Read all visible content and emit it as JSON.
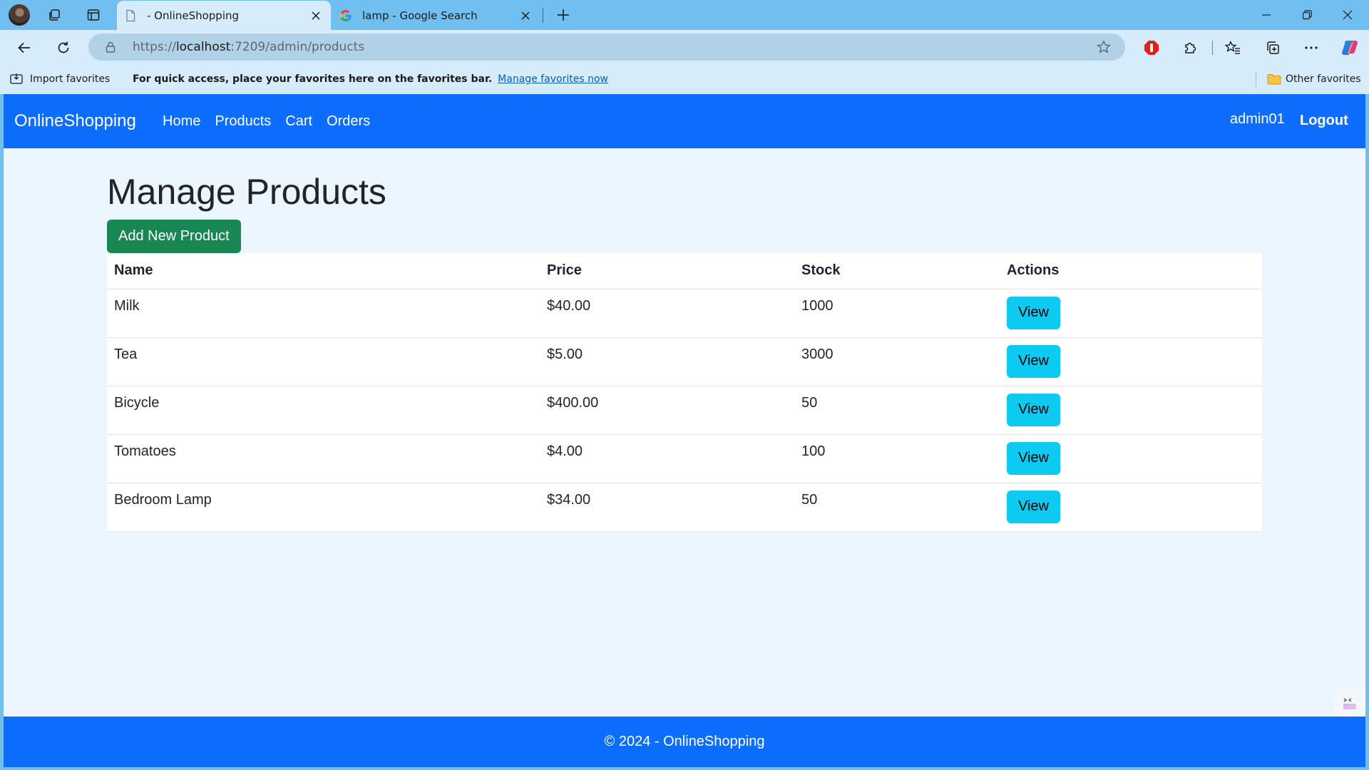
{
  "browser": {
    "tabs": [
      {
        "title": "- OnlineShopping",
        "icon": "page-icon",
        "active": true
      },
      {
        "title": "lamp - Google Search",
        "icon": "google-icon",
        "active": false
      }
    ],
    "address": {
      "scheme": "https://",
      "host": "localhost",
      "path": ":7209/admin/products"
    },
    "favorites_bar": {
      "import_label": "Import favorites",
      "hint": "For quick access, place your favorites here on the favorites bar.",
      "manage_link": "Manage favorites now",
      "other_label": "Other favorites"
    }
  },
  "site": {
    "brand": "OnlineShopping",
    "nav": [
      "Home",
      "Products",
      "Cart",
      "Orders"
    ],
    "user": "admin01",
    "logout": "Logout"
  },
  "main": {
    "title": "Manage Products",
    "add_button": "Add New Product",
    "columns": [
      "Name",
      "Price",
      "Stock",
      "Actions"
    ],
    "rows": [
      {
        "name": "Milk",
        "price": "$40.00",
        "stock": "1000",
        "action": "View"
      },
      {
        "name": "Tea",
        "price": "$5.00",
        "stock": "3000",
        "action": "View"
      },
      {
        "name": "Bicycle",
        "price": "$400.00",
        "stock": "50",
        "action": "View"
      },
      {
        "name": "Tomatoes",
        "price": "$4.00",
        "stock": "100",
        "action": "View"
      },
      {
        "name": "Bedroom Lamp",
        "price": "$34.00",
        "stock": "50",
        "action": "View"
      }
    ]
  },
  "footer": {
    "text": "© 2024 - OnlineShopping"
  },
  "colors": {
    "primary": "#0d6efd",
    "success": "#198754",
    "info": "#0dcaf0",
    "tabstrip": "#70bff0"
  }
}
